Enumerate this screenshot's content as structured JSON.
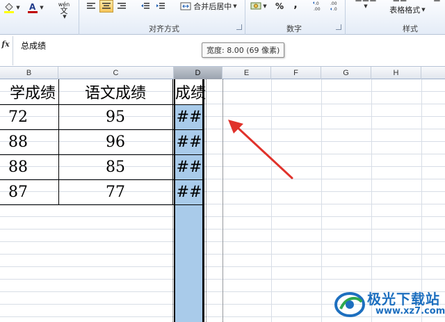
{
  "ribbon": {
    "groups": {
      "alignment_label": "对齐方式",
      "number_label": "数字",
      "styles_label": "样式"
    },
    "wen_label": "wén",
    "wen_char": "文",
    "merge_center_label": "合并后居中",
    "percent_label": "%",
    "comma_label": ",",
    "dec_increase_label": ".0 .00",
    "dec_decrease_label": ".00 →.0",
    "table_format_label": "表格格式",
    "font_color": "#c00000",
    "fill_color": "#ffff00",
    "active_button": "align-center"
  },
  "formula_bar": {
    "fx_label": "fx",
    "content": "总成绩",
    "tooltip": "宽度: 8.00 (69 像素)"
  },
  "columns": [
    "B",
    "C",
    "D",
    "E",
    "F",
    "G",
    "H"
  ],
  "selected_column": "D",
  "table": {
    "headers": [
      "学成绩",
      "语文成绩",
      "成绩"
    ],
    "rows": [
      [
        "72",
        "95",
        "##"
      ],
      [
        "88",
        "96",
        "##"
      ],
      [
        "88",
        "85",
        "##"
      ],
      [
        "87",
        "77",
        "##"
      ]
    ]
  },
  "colors": {
    "selection_fill": "#a9cbea",
    "arrow": "#e0322b",
    "grid": "#d7dde6"
  },
  "watermark": {
    "text": "极光下载站",
    "url": "www.xz7.com"
  }
}
